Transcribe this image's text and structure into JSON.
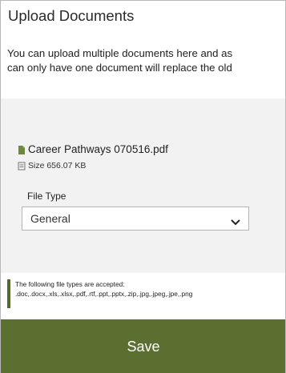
{
  "panel": {
    "title": "Upload Documents",
    "intro_line_1": "You can upload multiple documents here and as",
    "intro_line_2": "can only have one document will replace the old"
  },
  "file": {
    "name": "Career Pathways 070516.pdf",
    "size": "Size 656.07 KB"
  },
  "file_type": {
    "label": "File Type",
    "selected": "General"
  },
  "notice": {
    "line_1": "The following file types are accepted:",
    "line_2": ".doc,.docx,.xls,.xlsx,.pdf,.rtf,.ppt,.pptx,.zip,.jpg,.jpeg,.jpe,.png"
  },
  "actions": {
    "save_label": "Save"
  },
  "colors": {
    "accent": "#5b7030",
    "notice_border": "#526b2a"
  },
  "icons": {
    "file": "file-icon",
    "size": "size-icon",
    "select_arrow": "chevron-down-icon"
  }
}
